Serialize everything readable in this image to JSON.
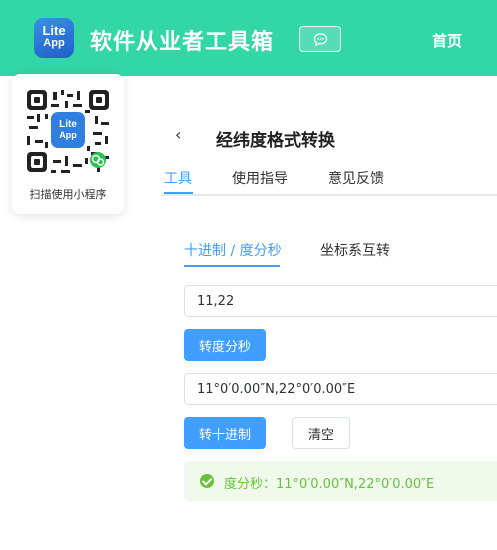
{
  "header": {
    "logo_line1": "Lite",
    "logo_line2": "App",
    "title": "软件从业者工具箱",
    "nav_home": "首页",
    "feedback_icon": "chat-bubble-icon",
    "bg_color": "#33d6a5"
  },
  "qr": {
    "caption": "扫描使用小程序",
    "center_logo_line1": "Lite",
    "center_logo_line2": "App"
  },
  "page": {
    "back_icon": "‹",
    "title": "经纬度格式转换"
  },
  "tabs": [
    {
      "label": "工具",
      "active": true
    },
    {
      "label": "使用指导",
      "active": false
    },
    {
      "label": "意见反馈",
      "active": false
    }
  ],
  "subtabs": [
    {
      "label": "十进制 / 度分秒",
      "active": true
    },
    {
      "label": "坐标系互转",
      "active": false
    }
  ],
  "converter": {
    "decimal_value": "11,22",
    "to_dms_label": "转度分秒",
    "dms_value": "11°0′0.00″N,22°0′0.00″E",
    "to_decimal_label": "转十进制",
    "clear_label": "清空",
    "result_text": "度分秒：11°0′0.00″N,22°0′0.00″E"
  },
  "colors": {
    "accent": "#409eff",
    "success": "#67c23a",
    "success_bg": "#f0f9eb"
  }
}
